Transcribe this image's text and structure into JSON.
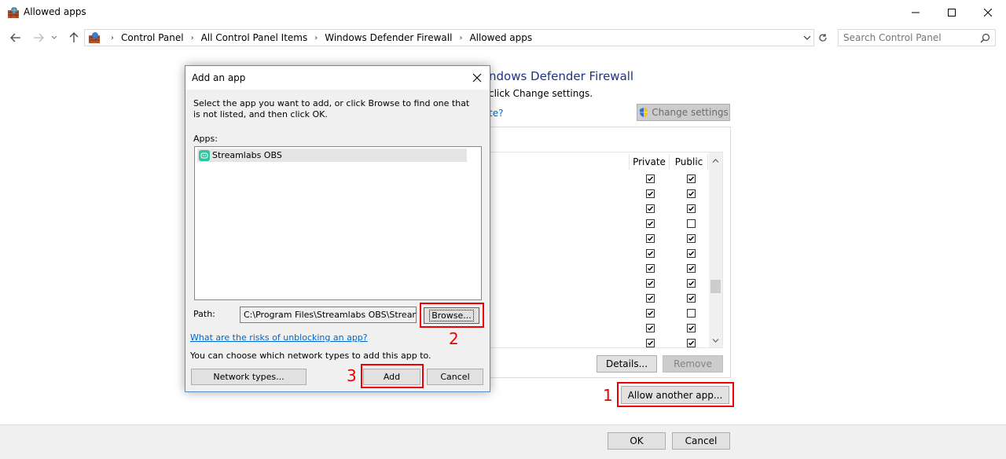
{
  "window": {
    "title": "Allowed apps",
    "controls": [
      "minimize",
      "maximize",
      "close"
    ]
  },
  "address_bar": {
    "breadcrumbs": [
      "Control Panel",
      "All Control Panel Items",
      "Windows Defender Firewall",
      "Allowed apps"
    ],
    "search_placeholder": "Search Control Panel"
  },
  "main": {
    "heading": "ndows Defender Firewall",
    "subtext": "click Change settings.",
    "link_fragment": "te?",
    "change_settings_label": "Change settings",
    "columns": [
      "Private",
      "Public"
    ],
    "rows": [
      {
        "private": true,
        "public": true
      },
      {
        "private": true,
        "public": true
      },
      {
        "private": true,
        "public": true
      },
      {
        "private": true,
        "public": false
      },
      {
        "private": true,
        "public": true
      },
      {
        "private": true,
        "public": true
      },
      {
        "private": true,
        "public": true
      },
      {
        "private": true,
        "public": true
      },
      {
        "private": true,
        "public": true
      },
      {
        "private": true,
        "public": false
      },
      {
        "private": true,
        "public": true
      },
      {
        "private": true,
        "public": true
      }
    ],
    "details_label": "Details...",
    "remove_label": "Remove",
    "allow_another_label": "Allow another app...",
    "ok_label": "OK",
    "cancel_label": "Cancel"
  },
  "dialog": {
    "title": "Add an app",
    "description": "Select the app you want to add, or click Browse to find one that is not listed, and then click OK.",
    "apps_label": "Apps:",
    "apps": [
      {
        "name": "Streamlabs OBS",
        "selected": true
      }
    ],
    "path_label": "Path:",
    "path_value": "C:\\Program Files\\Streamlabs OBS\\Streamlabs",
    "browse_label": "Browse...",
    "risks_link": "What are the risks of unblocking an app?",
    "network_note": "You can choose which network types to add this app to.",
    "network_types_label": "Network types...",
    "add_label": "Add",
    "cancel_label": "Cancel"
  },
  "annotations": {
    "step1": "1",
    "step2": "2",
    "step3": "3",
    "highlight_color": "#e00000"
  },
  "colors": {
    "heading_blue": "#1e3287",
    "link_blue": "#0066cc",
    "dialog_border": "#5a8cc8"
  }
}
